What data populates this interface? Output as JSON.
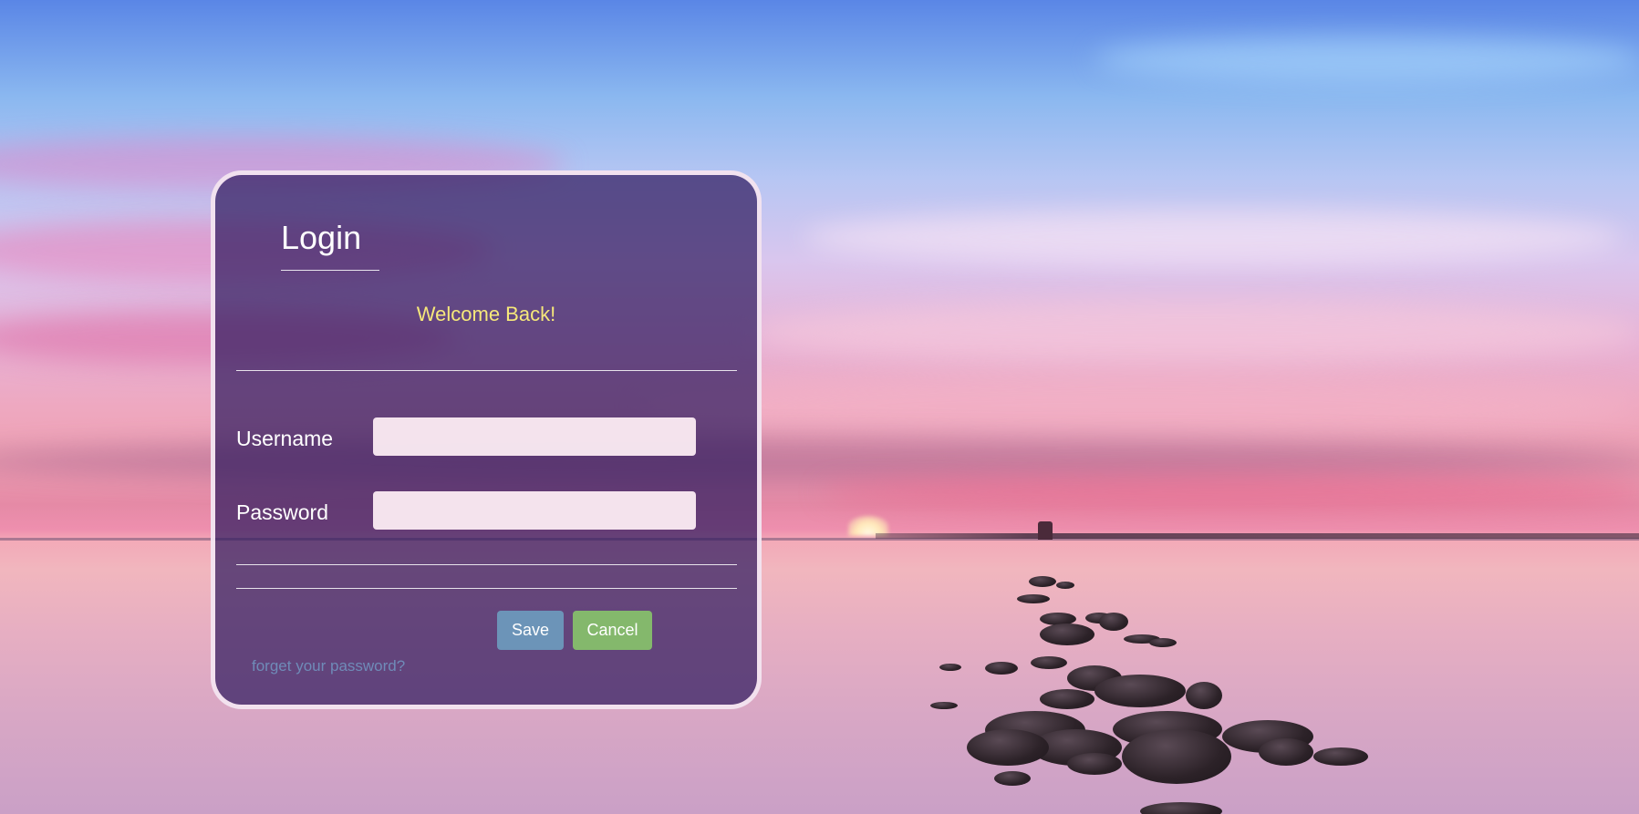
{
  "login": {
    "title": "Login",
    "welcome_message": "Welcome Back!",
    "username_label": "Username",
    "username_value": "",
    "password_label": "Password",
    "password_value": "",
    "save_label": "Save",
    "cancel_label": "Cancel",
    "forgot_link": "forget your password?"
  },
  "colors": {
    "card_background": "#301c60",
    "welcome_text": "#f6e87a",
    "save_button": "#6c94b8",
    "cancel_button": "#84b86c",
    "forgot_link": "#6f8bb8"
  }
}
